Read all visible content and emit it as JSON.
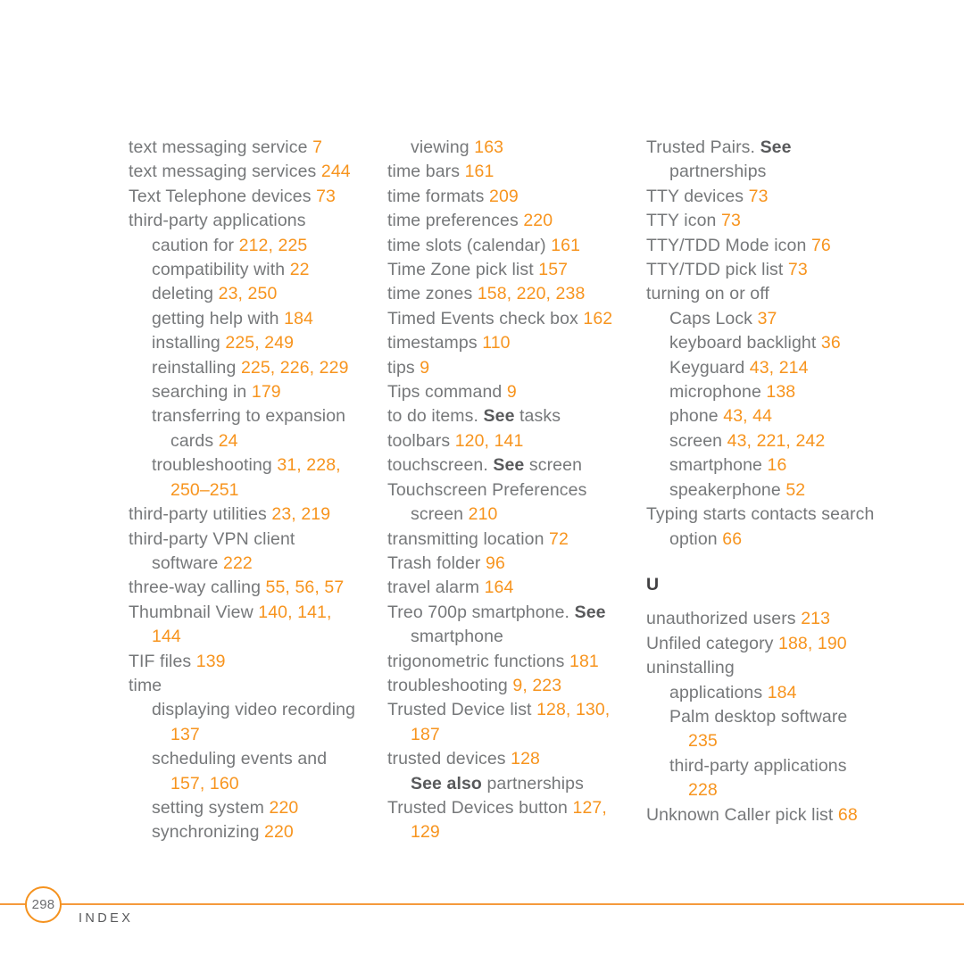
{
  "document": {
    "type": "book-index",
    "page_number": "298",
    "footer_label": "INDEX",
    "colors": {
      "entry_text": "#76787a",
      "page_number": "#f7941e",
      "rule": "#f59a3c",
      "section_letter": "#414042",
      "background": "#ffffff"
    }
  },
  "columns": [
    {
      "id": "column-1",
      "entries": [
        {
          "level": 0,
          "parts": [
            {
              "t": "text messaging service ",
              "k": "text"
            },
            {
              "t": "7",
              "k": "page"
            }
          ]
        },
        {
          "level": 0,
          "parts": [
            {
              "t": "text messaging services ",
              "k": "text"
            },
            {
              "t": "244",
              "k": "page"
            }
          ]
        },
        {
          "level": 0,
          "parts": [
            {
              "t": "Text Telephone devices ",
              "k": "text"
            },
            {
              "t": "73",
              "k": "page"
            }
          ]
        },
        {
          "level": 0,
          "parts": [
            {
              "t": "third-party applications",
              "k": "text"
            }
          ]
        },
        {
          "level": 1,
          "parts": [
            {
              "t": "caution for ",
              "k": "text"
            },
            {
              "t": "212, 225",
              "k": "page"
            }
          ]
        },
        {
          "level": 1,
          "parts": [
            {
              "t": "compatibility with ",
              "k": "text"
            },
            {
              "t": "22",
              "k": "page"
            }
          ]
        },
        {
          "level": 1,
          "parts": [
            {
              "t": "deleting ",
              "k": "text"
            },
            {
              "t": "23, 250",
              "k": "page"
            }
          ]
        },
        {
          "level": 1,
          "parts": [
            {
              "t": "getting help with ",
              "k": "text"
            },
            {
              "t": "184",
              "k": "page"
            }
          ]
        },
        {
          "level": 1,
          "parts": [
            {
              "t": "installing ",
              "k": "text"
            },
            {
              "t": "225, 249",
              "k": "page"
            }
          ]
        },
        {
          "level": 1,
          "parts": [
            {
              "t": "reinstalling ",
              "k": "text"
            },
            {
              "t": "225, 226, 229",
              "k": "page"
            }
          ]
        },
        {
          "level": 1,
          "parts": [
            {
              "t": "searching in ",
              "k": "text"
            },
            {
              "t": "179",
              "k": "page"
            }
          ]
        },
        {
          "level": 1,
          "parts": [
            {
              "t": "transferring to expansion",
              "k": "text"
            }
          ]
        },
        {
          "level": 2,
          "parts": [
            {
              "t": "cards ",
              "k": "text"
            },
            {
              "t": "24",
              "k": "page"
            }
          ]
        },
        {
          "level": 1,
          "parts": [
            {
              "t": "troubleshooting ",
              "k": "text"
            },
            {
              "t": "31, 228,",
              "k": "page"
            }
          ]
        },
        {
          "level": 2,
          "parts": [
            {
              "t": "250–251",
              "k": "page"
            }
          ]
        },
        {
          "level": 0,
          "parts": [
            {
              "t": "third-party utilities ",
              "k": "text"
            },
            {
              "t": "23, 219",
              "k": "page"
            }
          ]
        },
        {
          "level": 0,
          "parts": [
            {
              "t": "third-party VPN client",
              "k": "text"
            }
          ]
        },
        {
          "level": 1,
          "parts": [
            {
              "t": "software ",
              "k": "text"
            },
            {
              "t": "222",
              "k": "page"
            }
          ]
        },
        {
          "level": 0,
          "parts": [
            {
              "t": "three-way calling ",
              "k": "text"
            },
            {
              "t": "55, 56, 57",
              "k": "page"
            }
          ]
        },
        {
          "level": 0,
          "parts": [
            {
              "t": "Thumbnail View ",
              "k": "text"
            },
            {
              "t": "140, 141,",
              "k": "page"
            }
          ]
        },
        {
          "level": 1,
          "parts": [
            {
              "t": "144",
              "k": "page"
            }
          ]
        },
        {
          "level": 0,
          "parts": [
            {
              "t": "TIF files ",
              "k": "text"
            },
            {
              "t": "139",
              "k": "page"
            }
          ]
        },
        {
          "level": 0,
          "parts": [
            {
              "t": "time",
              "k": "text"
            }
          ]
        },
        {
          "level": 1,
          "parts": [
            {
              "t": "displaying video recording",
              "k": "text"
            }
          ]
        },
        {
          "level": 2,
          "parts": [
            {
              "t": "137",
              "k": "page"
            }
          ]
        },
        {
          "level": 1,
          "parts": [
            {
              "t": "scheduling events and",
              "k": "text"
            }
          ]
        },
        {
          "level": 2,
          "parts": [
            {
              "t": "157, 160",
              "k": "page"
            }
          ]
        },
        {
          "level": 1,
          "parts": [
            {
              "t": "setting system ",
              "k": "text"
            },
            {
              "t": "220",
              "k": "page"
            }
          ]
        },
        {
          "level": 1,
          "parts": [
            {
              "t": "synchronizing ",
              "k": "text"
            },
            {
              "t": "220",
              "k": "page"
            }
          ]
        }
      ]
    },
    {
      "id": "column-2",
      "entries": [
        {
          "level": 1,
          "parts": [
            {
              "t": "viewing ",
              "k": "text"
            },
            {
              "t": "163",
              "k": "page"
            }
          ]
        },
        {
          "level": 0,
          "parts": [
            {
              "t": "time bars ",
              "k": "text"
            },
            {
              "t": "161",
              "k": "page"
            }
          ]
        },
        {
          "level": 0,
          "parts": [
            {
              "t": "time formats ",
              "k": "text"
            },
            {
              "t": "209",
              "k": "page"
            }
          ]
        },
        {
          "level": 0,
          "parts": [
            {
              "t": "time preferences ",
              "k": "text"
            },
            {
              "t": "220",
              "k": "page"
            }
          ]
        },
        {
          "level": 0,
          "parts": [
            {
              "t": "time slots (calendar) ",
              "k": "text"
            },
            {
              "t": "161",
              "k": "page"
            }
          ]
        },
        {
          "level": 0,
          "parts": [
            {
              "t": "Time Zone pick list ",
              "k": "text"
            },
            {
              "t": "157",
              "k": "page"
            }
          ]
        },
        {
          "level": 0,
          "parts": [
            {
              "t": "time zones ",
              "k": "text"
            },
            {
              "t": "158, 220, 238",
              "k": "page"
            }
          ]
        },
        {
          "level": 0,
          "parts": [
            {
              "t": "Timed Events check box ",
              "k": "text"
            },
            {
              "t": "162",
              "k": "page"
            }
          ]
        },
        {
          "level": 0,
          "parts": [
            {
              "t": "timestamps ",
              "k": "text"
            },
            {
              "t": "110",
              "k": "page"
            }
          ]
        },
        {
          "level": 0,
          "parts": [
            {
              "t": "tips ",
              "k": "text"
            },
            {
              "t": "9",
              "k": "page"
            }
          ]
        },
        {
          "level": 0,
          "parts": [
            {
              "t": "Tips command ",
              "k": "text"
            },
            {
              "t": "9",
              "k": "page"
            }
          ]
        },
        {
          "level": 0,
          "parts": [
            {
              "t": "to do items. ",
              "k": "text"
            },
            {
              "t": "See",
              "k": "see"
            },
            {
              "t": " tasks",
              "k": "text"
            }
          ]
        },
        {
          "level": 0,
          "parts": [
            {
              "t": "toolbars ",
              "k": "text"
            },
            {
              "t": "120, 141",
              "k": "page"
            }
          ]
        },
        {
          "level": 0,
          "parts": [
            {
              "t": "touchscreen. ",
              "k": "text"
            },
            {
              "t": "See",
              "k": "see"
            },
            {
              "t": " screen",
              "k": "text"
            }
          ]
        },
        {
          "level": 0,
          "parts": [
            {
              "t": "Touchscreen Preferences",
              "k": "text"
            }
          ]
        },
        {
          "level": 1,
          "parts": [
            {
              "t": "screen ",
              "k": "text"
            },
            {
              "t": "210",
              "k": "page"
            }
          ]
        },
        {
          "level": 0,
          "parts": [
            {
              "t": "transmitting location ",
              "k": "text"
            },
            {
              "t": "72",
              "k": "page"
            }
          ]
        },
        {
          "level": 0,
          "parts": [
            {
              "t": "Trash folder ",
              "k": "text"
            },
            {
              "t": "96",
              "k": "page"
            }
          ]
        },
        {
          "level": 0,
          "parts": [
            {
              "t": "travel alarm ",
              "k": "text"
            },
            {
              "t": "164",
              "k": "page"
            }
          ]
        },
        {
          "level": 0,
          "parts": [
            {
              "t": "Treo 700p smartphone. ",
              "k": "text"
            },
            {
              "t": "See",
              "k": "see"
            }
          ]
        },
        {
          "level": 1,
          "parts": [
            {
              "t": "smartphone",
              "k": "text"
            }
          ]
        },
        {
          "level": 0,
          "parts": [
            {
              "t": "trigonometric functions ",
              "k": "text"
            },
            {
              "t": "181",
              "k": "page"
            }
          ]
        },
        {
          "level": 0,
          "parts": [
            {
              "t": "troubleshooting ",
              "k": "text"
            },
            {
              "t": "9, 223",
              "k": "page"
            }
          ]
        },
        {
          "level": 0,
          "parts": [
            {
              "t": "Trusted Device list ",
              "k": "text"
            },
            {
              "t": "128, 130,",
              "k": "page"
            }
          ]
        },
        {
          "level": 1,
          "parts": [
            {
              "t": "187",
              "k": "page"
            }
          ]
        },
        {
          "level": 0,
          "parts": [
            {
              "t": "trusted devices ",
              "k": "text"
            },
            {
              "t": "128",
              "k": "page"
            }
          ]
        },
        {
          "level": 1,
          "parts": [
            {
              "t": "See also",
              "k": "see"
            },
            {
              "t": " partnerships",
              "k": "text"
            }
          ]
        },
        {
          "level": 0,
          "parts": [
            {
              "t": "Trusted Devices button ",
              "k": "text"
            },
            {
              "t": "127,",
              "k": "page"
            }
          ]
        },
        {
          "level": 1,
          "parts": [
            {
              "t": "129",
              "k": "page"
            }
          ]
        }
      ]
    },
    {
      "id": "column-3",
      "entries": [
        {
          "level": 0,
          "parts": [
            {
              "t": "Trusted Pairs. ",
              "k": "text"
            },
            {
              "t": "See",
              "k": "see"
            }
          ]
        },
        {
          "level": 1,
          "parts": [
            {
              "t": "partnerships",
              "k": "text"
            }
          ]
        },
        {
          "level": 0,
          "parts": [
            {
              "t": "TTY devices ",
              "k": "text"
            },
            {
              "t": "73",
              "k": "page"
            }
          ]
        },
        {
          "level": 0,
          "parts": [
            {
              "t": "TTY icon ",
              "k": "text"
            },
            {
              "t": "73",
              "k": "page"
            }
          ]
        },
        {
          "level": 0,
          "parts": [
            {
              "t": "TTY/TDD Mode icon ",
              "k": "text"
            },
            {
              "t": "76",
              "k": "page"
            }
          ]
        },
        {
          "level": 0,
          "parts": [
            {
              "t": "TTY/TDD pick list ",
              "k": "text"
            },
            {
              "t": "73",
              "k": "page"
            }
          ]
        },
        {
          "level": 0,
          "parts": [
            {
              "t": "turning on or off",
              "k": "text"
            }
          ]
        },
        {
          "level": 1,
          "parts": [
            {
              "t": "Caps Lock ",
              "k": "text"
            },
            {
              "t": "37",
              "k": "page"
            }
          ]
        },
        {
          "level": 1,
          "parts": [
            {
              "t": "keyboard backlight ",
              "k": "text"
            },
            {
              "t": "36",
              "k": "page"
            }
          ]
        },
        {
          "level": 1,
          "parts": [
            {
              "t": "Keyguard ",
              "k": "text"
            },
            {
              "t": "43, 214",
              "k": "page"
            }
          ]
        },
        {
          "level": 1,
          "parts": [
            {
              "t": "microphone ",
              "k": "text"
            },
            {
              "t": "138",
              "k": "page"
            }
          ]
        },
        {
          "level": 1,
          "parts": [
            {
              "t": "phone ",
              "k": "text"
            },
            {
              "t": "43, 44",
              "k": "page"
            }
          ]
        },
        {
          "level": 1,
          "parts": [
            {
              "t": "screen ",
              "k": "text"
            },
            {
              "t": "43, 221, 242",
              "k": "page"
            }
          ]
        },
        {
          "level": 1,
          "parts": [
            {
              "t": "smartphone ",
              "k": "text"
            },
            {
              "t": "16",
              "k": "page"
            }
          ]
        },
        {
          "level": 1,
          "parts": [
            {
              "t": "speakerphone ",
              "k": "text"
            },
            {
              "t": "52",
              "k": "page"
            }
          ]
        },
        {
          "level": 0,
          "parts": [
            {
              "t": "Typing starts contacts search",
              "k": "text"
            }
          ]
        },
        {
          "level": 1,
          "parts": [
            {
              "t": "option ",
              "k": "text"
            },
            {
              "t": "66",
              "k": "page"
            }
          ]
        },
        {
          "level": 0,
          "section_letter": "U",
          "parts": []
        },
        {
          "level": 0,
          "parts": [
            {
              "t": "unauthorized users ",
              "k": "text"
            },
            {
              "t": "213",
              "k": "page"
            }
          ]
        },
        {
          "level": 0,
          "parts": [
            {
              "t": "Unfiled category ",
              "k": "text"
            },
            {
              "t": "188, 190",
              "k": "page"
            }
          ]
        },
        {
          "level": 0,
          "parts": [
            {
              "t": "uninstalling",
              "k": "text"
            }
          ]
        },
        {
          "level": 1,
          "parts": [
            {
              "t": "applications ",
              "k": "text"
            },
            {
              "t": "184",
              "k": "page"
            }
          ]
        },
        {
          "level": 1,
          "parts": [
            {
              "t": "Palm desktop software",
              "k": "text"
            }
          ]
        },
        {
          "level": 2,
          "parts": [
            {
              "t": "235",
              "k": "page"
            }
          ]
        },
        {
          "level": 1,
          "parts": [
            {
              "t": "third-party applications",
              "k": "text"
            }
          ]
        },
        {
          "level": 2,
          "parts": [
            {
              "t": "228",
              "k": "page"
            }
          ]
        },
        {
          "level": 0,
          "parts": [
            {
              "t": "Unknown Caller pick list ",
              "k": "text"
            },
            {
              "t": "68",
              "k": "page"
            }
          ]
        }
      ]
    }
  ]
}
